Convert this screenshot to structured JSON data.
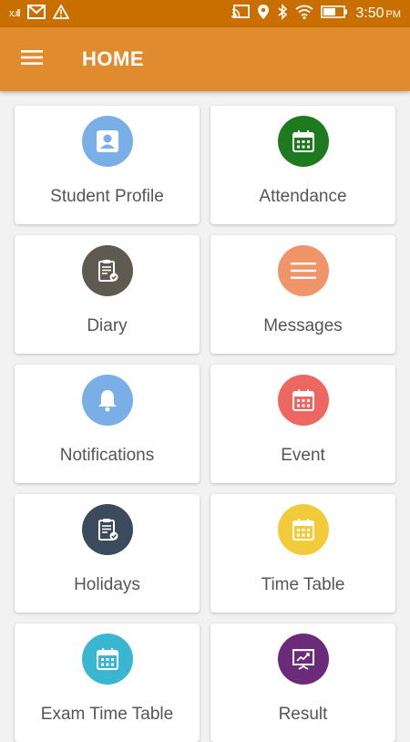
{
  "status_bar": {
    "signal_text": "x.ıll",
    "time": "3:50",
    "ampm": "PM"
  },
  "app_bar": {
    "title": "HOME",
    "menu_icon": "menu-icon"
  },
  "tiles": [
    {
      "label": "Student Profile",
      "icon": "profile-icon",
      "color": "#7aaee6"
    },
    {
      "label": "Attendance",
      "icon": "calendar-icon",
      "color": "#1e7a1e"
    },
    {
      "label": "Diary",
      "icon": "clipboard-icon",
      "color": "#5f5a50"
    },
    {
      "label": "Messages",
      "icon": "lines-icon",
      "color": "#f0956a"
    },
    {
      "label": "Notifications",
      "icon": "bell-icon",
      "color": "#7aaee6"
    },
    {
      "label": "Event",
      "icon": "calendar-icon",
      "color": "#ee6660"
    },
    {
      "label": "Holidays",
      "icon": "clipboard-icon",
      "color": "#3b4a5c"
    },
    {
      "label": "Time Table",
      "icon": "calendar-icon",
      "color": "#f2cb3a"
    },
    {
      "label": "Exam Time Table",
      "icon": "calendar-icon",
      "color": "#3ab6d2"
    },
    {
      "label": "Result",
      "icon": "chart-presentation-icon",
      "color": "#6b2a7a"
    }
  ]
}
